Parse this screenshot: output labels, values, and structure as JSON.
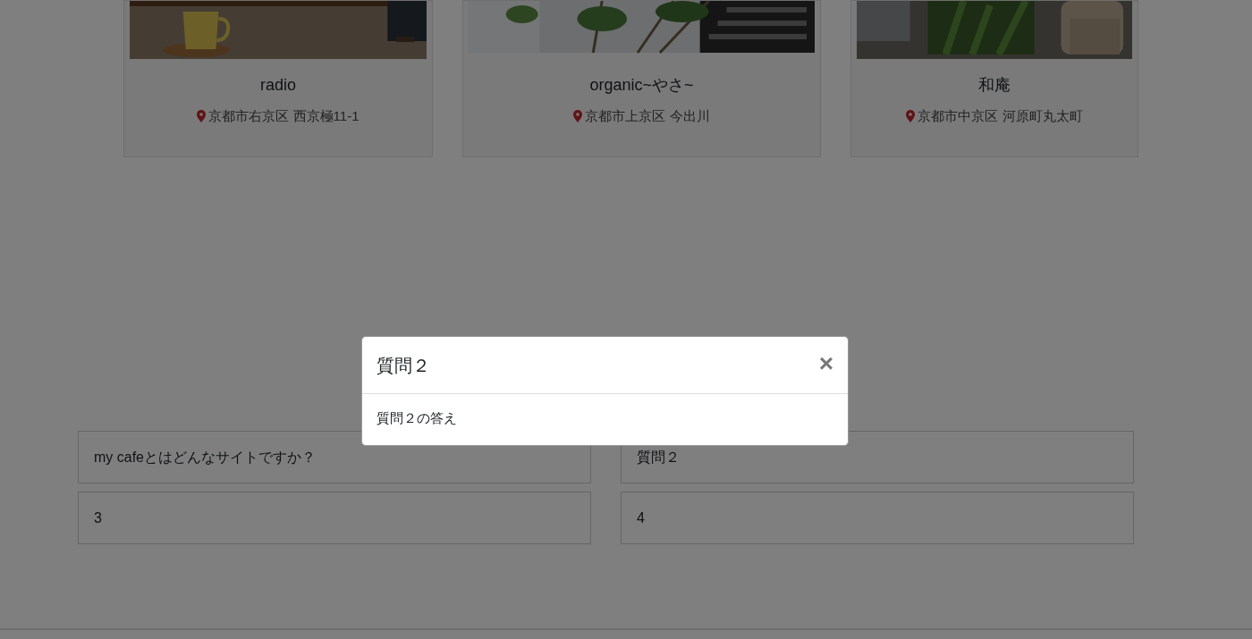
{
  "cards": [
    {
      "name": "radio",
      "address": "京都市右京区 西京極11-1"
    },
    {
      "name": "organic~やさ~",
      "address": "京都市上京区 今出川"
    },
    {
      "name": "和庵",
      "address": "京都市中京区 河原町丸太町"
    }
  ],
  "faq": [
    {
      "question": "my cafeとはどんなサイトですか？"
    },
    {
      "question": "質問２"
    },
    {
      "question": "3"
    },
    {
      "question": "4"
    }
  ],
  "modal": {
    "title": "質問２",
    "close": "×",
    "body": "質問２の答え"
  }
}
